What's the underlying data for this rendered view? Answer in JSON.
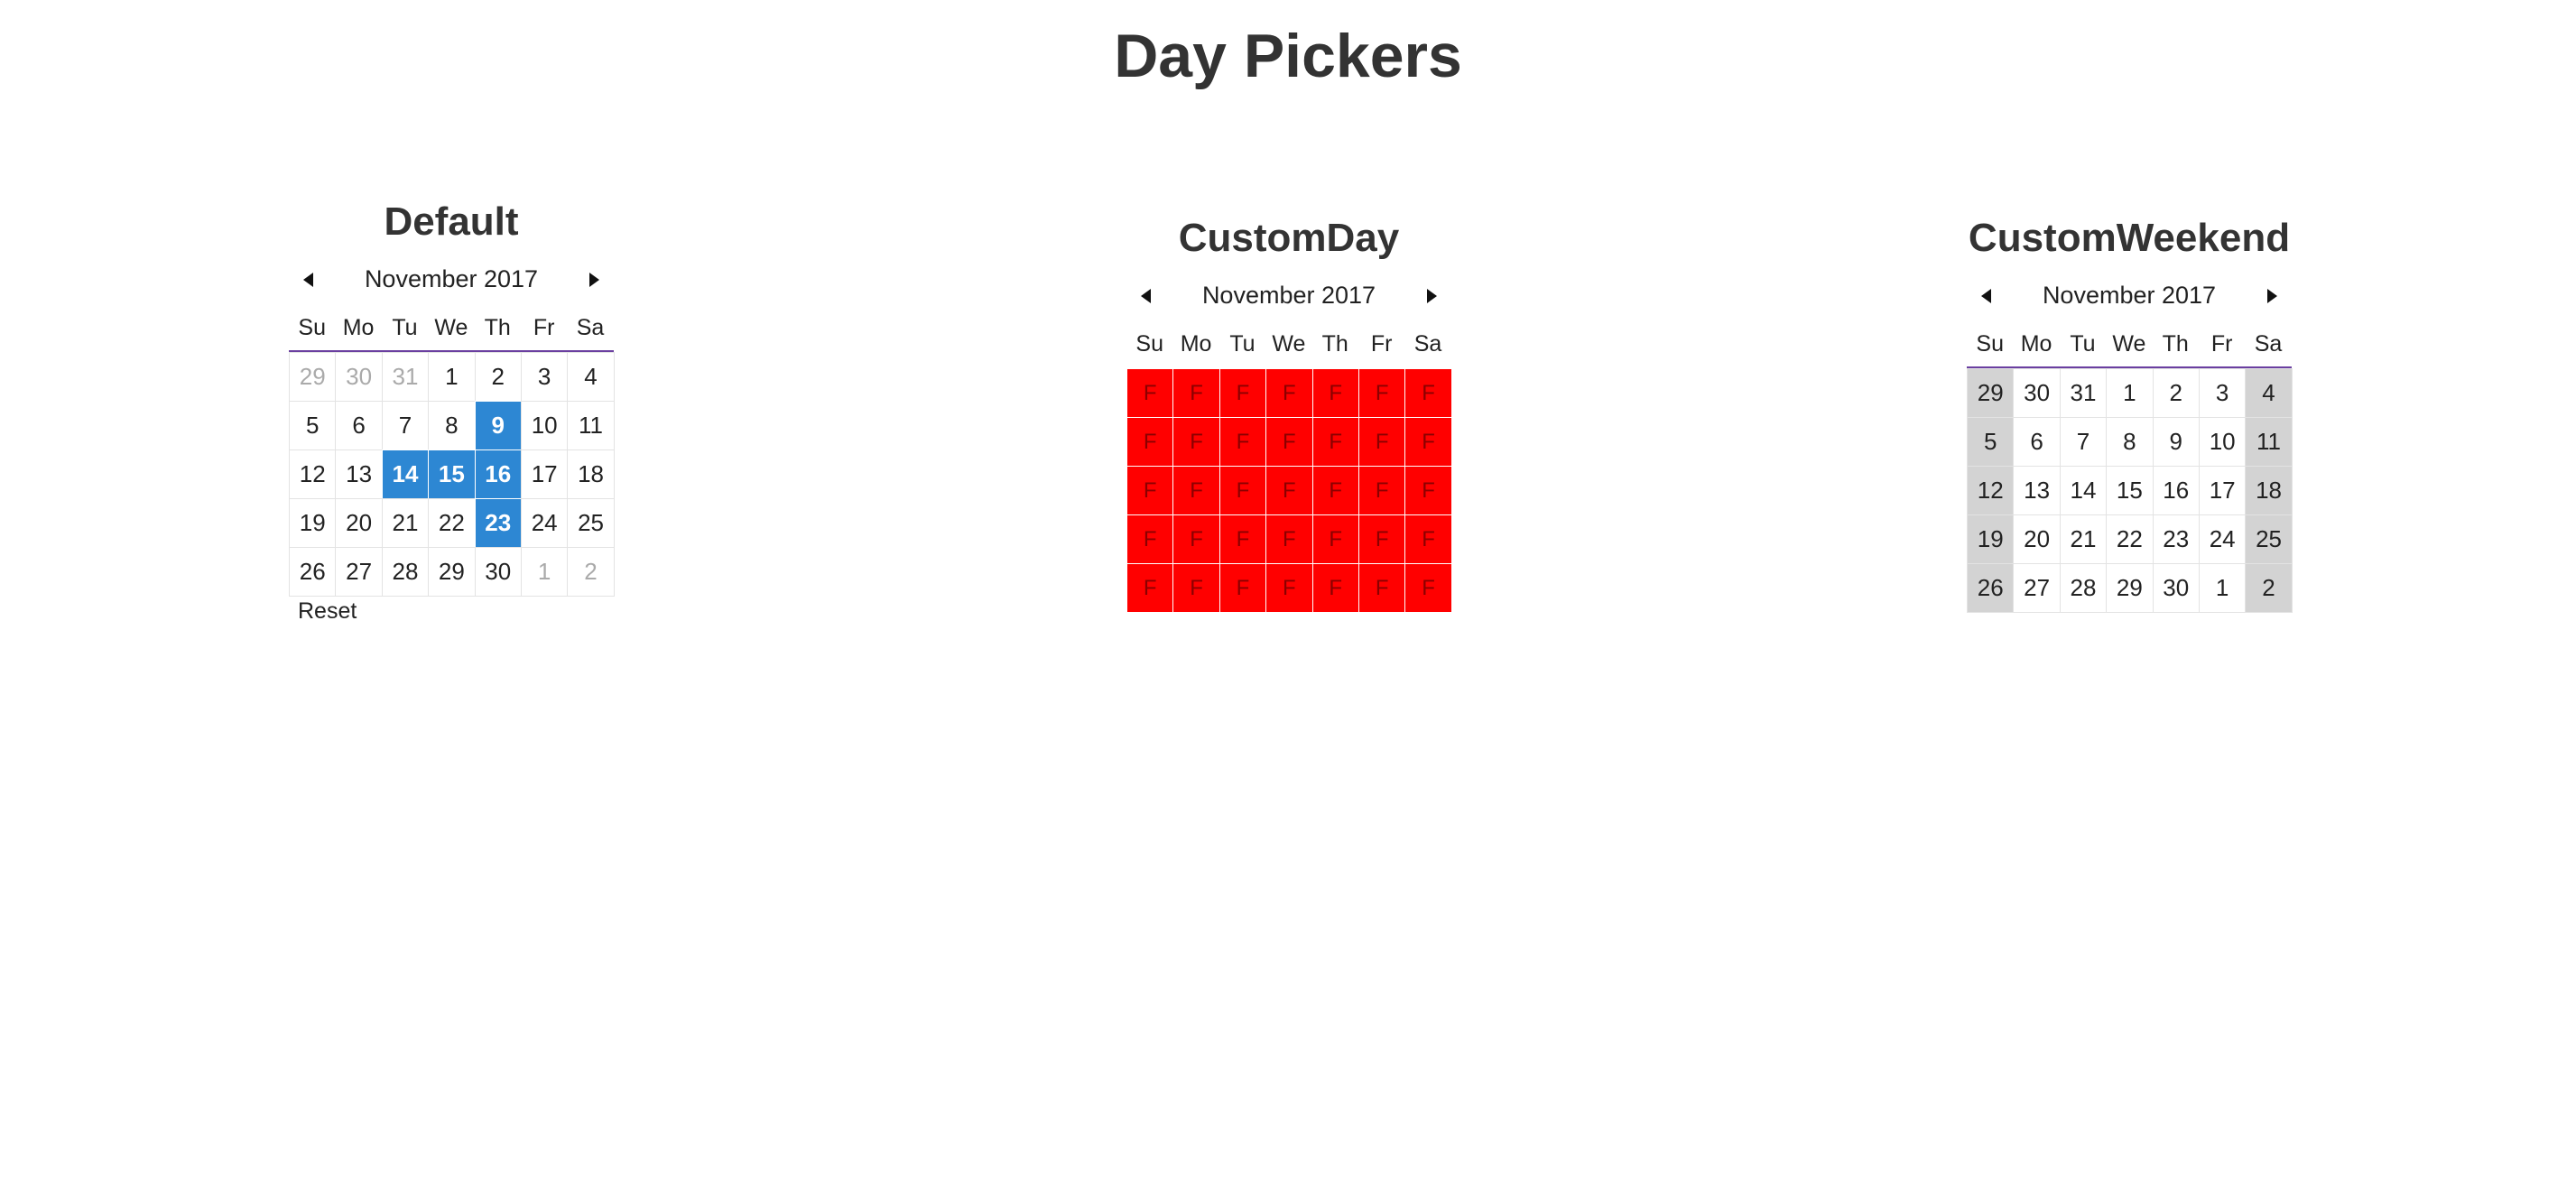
{
  "page": {
    "title": "Day Pickers"
  },
  "weekdays": [
    "Su",
    "Mo",
    "Tu",
    "We",
    "Th",
    "Fr",
    "Sa"
  ],
  "pickers": [
    {
      "id": "default",
      "title": "Default",
      "month_label": "November 2017",
      "reset_label": "Reset",
      "days": [
        {
          "label": "29",
          "state": "outside"
        },
        {
          "label": "30",
          "state": "outside"
        },
        {
          "label": "31",
          "state": "outside"
        },
        {
          "label": "1",
          "state": ""
        },
        {
          "label": "2",
          "state": ""
        },
        {
          "label": "3",
          "state": ""
        },
        {
          "label": "4",
          "state": ""
        },
        {
          "label": "5",
          "state": ""
        },
        {
          "label": "6",
          "state": ""
        },
        {
          "label": "7",
          "state": ""
        },
        {
          "label": "8",
          "state": ""
        },
        {
          "label": "9",
          "state": "selected"
        },
        {
          "label": "10",
          "state": ""
        },
        {
          "label": "11",
          "state": ""
        },
        {
          "label": "12",
          "state": ""
        },
        {
          "label": "13",
          "state": ""
        },
        {
          "label": "14",
          "state": "selected"
        },
        {
          "label": "15",
          "state": "selected"
        },
        {
          "label": "16",
          "state": "selected"
        },
        {
          "label": "17",
          "state": ""
        },
        {
          "label": "18",
          "state": ""
        },
        {
          "label": "19",
          "state": ""
        },
        {
          "label": "20",
          "state": ""
        },
        {
          "label": "21",
          "state": ""
        },
        {
          "label": "22",
          "state": ""
        },
        {
          "label": "23",
          "state": "selected"
        },
        {
          "label": "24",
          "state": ""
        },
        {
          "label": "25",
          "state": ""
        },
        {
          "label": "26",
          "state": ""
        },
        {
          "label": "27",
          "state": ""
        },
        {
          "label": "28",
          "state": ""
        },
        {
          "label": "29",
          "state": ""
        },
        {
          "label": "30",
          "state": ""
        },
        {
          "label": "1",
          "state": "outside"
        },
        {
          "label": "2",
          "state": "outside"
        }
      ]
    },
    {
      "id": "custom-day",
      "title": "CustomDay",
      "month_label": "November 2017",
      "days": [
        {
          "label": "F",
          "state": "red"
        },
        {
          "label": "F",
          "state": "red"
        },
        {
          "label": "F",
          "state": "red"
        },
        {
          "label": "F",
          "state": "red"
        },
        {
          "label": "F",
          "state": "red"
        },
        {
          "label": "F",
          "state": "red"
        },
        {
          "label": "F",
          "state": "red"
        },
        {
          "label": "F",
          "state": "red"
        },
        {
          "label": "F",
          "state": "red"
        },
        {
          "label": "F",
          "state": "red"
        },
        {
          "label": "F",
          "state": "red"
        },
        {
          "label": "F",
          "state": "red"
        },
        {
          "label": "F",
          "state": "red"
        },
        {
          "label": "F",
          "state": "red"
        },
        {
          "label": "F",
          "state": "red"
        },
        {
          "label": "F",
          "state": "red"
        },
        {
          "label": "F",
          "state": "red"
        },
        {
          "label": "F",
          "state": "red"
        },
        {
          "label": "F",
          "state": "red"
        },
        {
          "label": "F",
          "state": "red"
        },
        {
          "label": "F",
          "state": "red"
        },
        {
          "label": "F",
          "state": "red"
        },
        {
          "label": "F",
          "state": "red"
        },
        {
          "label": "F",
          "state": "red"
        },
        {
          "label": "F",
          "state": "red"
        },
        {
          "label": "F",
          "state": "red"
        },
        {
          "label": "F",
          "state": "red"
        },
        {
          "label": "F",
          "state": "red"
        },
        {
          "label": "F",
          "state": "red"
        },
        {
          "label": "F",
          "state": "red"
        },
        {
          "label": "F",
          "state": "red"
        },
        {
          "label": "F",
          "state": "red"
        },
        {
          "label": "F",
          "state": "red"
        },
        {
          "label": "F",
          "state": "red"
        },
        {
          "label": "F",
          "state": "red"
        }
      ]
    },
    {
      "id": "custom-weekend",
      "title": "CustomWeekend",
      "month_label": "November 2017",
      "days": [
        {
          "label": "29",
          "state": "weekend"
        },
        {
          "label": "30",
          "state": ""
        },
        {
          "label": "31",
          "state": ""
        },
        {
          "label": "1",
          "state": ""
        },
        {
          "label": "2",
          "state": ""
        },
        {
          "label": "3",
          "state": ""
        },
        {
          "label": "4",
          "state": "weekend"
        },
        {
          "label": "5",
          "state": "weekend"
        },
        {
          "label": "6",
          "state": ""
        },
        {
          "label": "7",
          "state": ""
        },
        {
          "label": "8",
          "state": ""
        },
        {
          "label": "9",
          "state": ""
        },
        {
          "label": "10",
          "state": ""
        },
        {
          "label": "11",
          "state": "weekend"
        },
        {
          "label": "12",
          "state": "weekend"
        },
        {
          "label": "13",
          "state": ""
        },
        {
          "label": "14",
          "state": ""
        },
        {
          "label": "15",
          "state": ""
        },
        {
          "label": "16",
          "state": ""
        },
        {
          "label": "17",
          "state": ""
        },
        {
          "label": "18",
          "state": "weekend"
        },
        {
          "label": "19",
          "state": "weekend"
        },
        {
          "label": "20",
          "state": ""
        },
        {
          "label": "21",
          "state": ""
        },
        {
          "label": "22",
          "state": ""
        },
        {
          "label": "23",
          "state": ""
        },
        {
          "label": "24",
          "state": ""
        },
        {
          "label": "25",
          "state": "weekend"
        },
        {
          "label": "26",
          "state": "weekend"
        },
        {
          "label": "27",
          "state": ""
        },
        {
          "label": "28",
          "state": ""
        },
        {
          "label": "29",
          "state": ""
        },
        {
          "label": "30",
          "state": ""
        },
        {
          "label": "1",
          "state": ""
        },
        {
          "label": "2",
          "state": "weekend"
        }
      ]
    }
  ],
  "colors": {
    "selected": "#2d87d3",
    "custom_day": "#ff0000",
    "weekend": "#d3d3d3",
    "weekday_header_rule": "#6a3fa0"
  },
  "icons": {
    "prev": "caret-left-icon",
    "next": "caret-right-icon"
  }
}
